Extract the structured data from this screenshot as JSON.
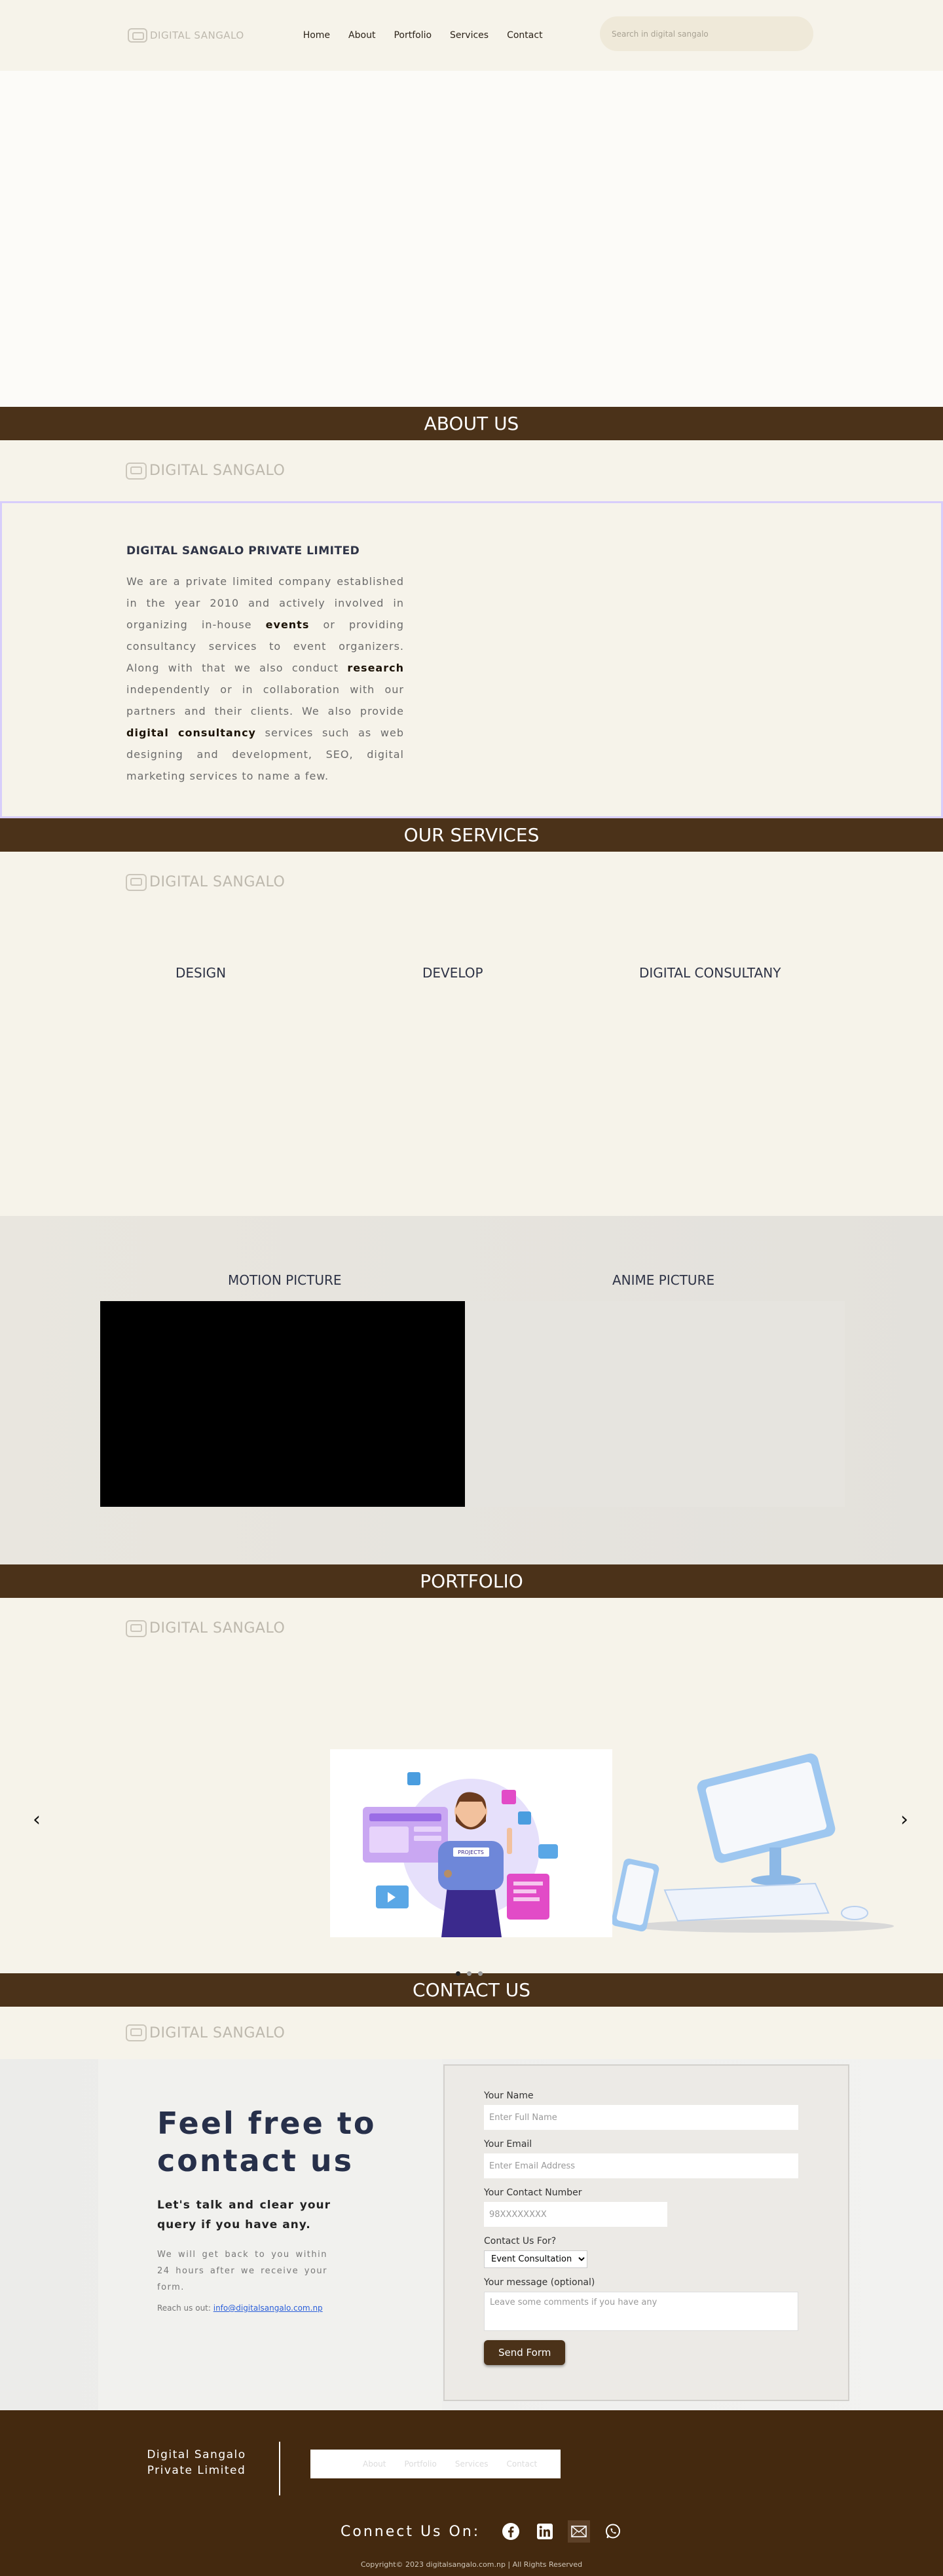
{
  "nav": {
    "logo_text": "DIGITAL SANGALO",
    "links": [
      "Home",
      "About",
      "Portfolio",
      "Services",
      "Contact"
    ],
    "search_placeholder": "Search in digital sangalo"
  },
  "about": {
    "heading": "ABOUT US",
    "logo_text": "DIGITAL SANGALO",
    "company": "DIGITAL SANGALO PRIVATE LIMITED",
    "text_1": "We are a private limited company established in the year 2010 and actively involved in organizing in-house ",
    "bold_1": "events",
    "text_2": " or providing consultancy services to event organizers. Along with that we also conduct ",
    "bold_2": "research",
    "text_3": " independently or in collaboration with our partners and their clients. We also provide ",
    "bold_3": "digital consultancy",
    "text_4": " services such as web designing and development, SEO, digital marketing services to name a few."
  },
  "services": {
    "heading": "OUR SERVICES",
    "logo_text": "DIGITAL SANGALO",
    "items": [
      "DESIGN",
      "DEVELOP",
      "DIGITAL CONSULTANY"
    ],
    "motion_label": "MOTION PICTURE",
    "anime_label": "ANIME PICTURE"
  },
  "portfolio": {
    "heading": "PORTFOLIO",
    "logo_text": "DIGITAL SANGALO",
    "prev": "‹",
    "next": "›",
    "slide_count": 3,
    "active_slide": 1,
    "badge": "PROJECTS"
  },
  "contact": {
    "heading": "CONTACT US",
    "logo_text": "DIGITAL SANGALO",
    "title": "Feel free to contact us",
    "lead": "Let's talk and clear your query if you have any.",
    "small": "We will get back to you within 24 hours after we receive your form.",
    "reach_prefix": "Reach us out: ",
    "email": "info@digitalsangalo.com.np",
    "form": {
      "name_label": "Your Name",
      "name_placeholder": "Enter Full Name",
      "email_label": "Your Email",
      "email_placeholder": "Enter Email Address",
      "phone_label": "Your Contact Number",
      "phone_placeholder": "98XXXXXXXX",
      "for_label": "Contact Us For?",
      "for_selected": "Event Consultation",
      "msg_label": "Your message (optional)",
      "msg_placeholder": "Leave some comments if you have any",
      "submit": "Send Form"
    }
  },
  "footer": {
    "company": "Digital Sangalo Private Limited",
    "links": [
      "About",
      "Portfolio",
      "Services",
      "Contact"
    ],
    "connect": "Connect Us On:",
    "social": [
      "facebook-icon",
      "linkedin-icon",
      "mail-icon",
      "whatsapp-icon"
    ],
    "copyright": "Copyright© 2023 digitalsangalo.com.np | All Rights Reserved"
  },
  "colors": {
    "brown_band": "#4b3219",
    "footer_bg": "#44290f",
    "cream": "#f6f3ea"
  }
}
